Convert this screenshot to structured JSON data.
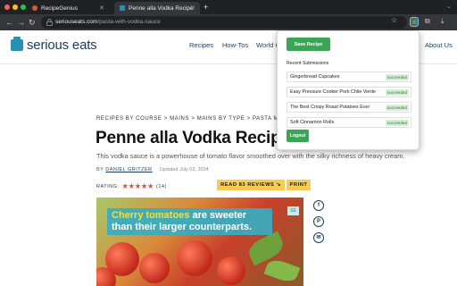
{
  "browser": {
    "tabs": [
      {
        "label": "RecipeGenius",
        "active": false
      },
      {
        "label": "Penne alla Vodka Recipe",
        "active": true
      }
    ],
    "url_host": "seriouseats.com",
    "url_path": "/pasta-with-vodka-sauce",
    "new_tab": "+",
    "colors": {
      "chrome_dark": "#202124",
      "chrome_toolbar": "#35363a"
    }
  },
  "site": {
    "logo_text": "serious eats",
    "nav": {
      "recipes": "Recipes",
      "howtos": "How-Tos",
      "world": "World C",
      "about": "About Us"
    }
  },
  "article": {
    "breadcrumb": "RECIPES BY COURSE  >  MAINS  >  MAINS BY TYPE  >  PASTA M",
    "title": "Penne alla Vodka Recip",
    "description": "This vodka sauce is a powerhouse of tomato flavor smoothed over with the silky richness of heavy cream.",
    "byline_prefix": "BY",
    "author": "DANIEL GRITZER",
    "date": "Updated July 03, 2024",
    "rating_label": "RATING:",
    "stars": "★★★★★",
    "rating_count": "(14)",
    "read_reviews": "READ 83 REVIEWS ↘",
    "print": "PRINT",
    "hero_caption_highlight": "Cherry tomatoes",
    "hero_caption_rest": " are sweeter than their larger counterparts.",
    "hero_badge": "SE",
    "share_icons": [
      "facebook-icon",
      "pinterest-icon",
      "email-icon"
    ]
  },
  "popup": {
    "save_label": "Save Recipe",
    "heading": "Recent Submissions",
    "submissions": [
      {
        "name": "Gingerbread Cupcakes",
        "status": "succeeded"
      },
      {
        "name": "Easy Pressure Cooker Pork Chile Verde",
        "status": "succeeded"
      },
      {
        "name": "The Best Crispy Roast Potatoes Ever",
        "status": "succeeded"
      },
      {
        "name": "Soft Cinnamon Rolls",
        "status": "succeeded"
      }
    ],
    "logout_label": "Logout",
    "accent": "#3aa655"
  }
}
